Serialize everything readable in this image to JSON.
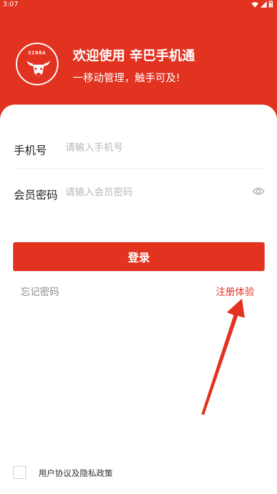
{
  "status_bar": {
    "time": "3:07"
  },
  "header": {
    "logo_text": "XINBA",
    "title": "欢迎使用 辛巴手机通",
    "subtitle": "一移动管理，触手可及!"
  },
  "form": {
    "phone": {
      "label": "手机号",
      "placeholder": "请输入手机号",
      "value": ""
    },
    "password": {
      "label": "会员密码",
      "placeholder": "请输入会员密码",
      "value": ""
    },
    "login_label": "登录",
    "forgot_label": "忘记密码",
    "register_label": "注册体验"
  },
  "agreement": {
    "label": "用户协议及隐私政策",
    "checked": false
  },
  "colors": {
    "brand": "#e23220",
    "placeholder": "#b8b8b8",
    "muted": "#8a8a8a"
  },
  "icons": [
    "wifi-icon",
    "signal-icon",
    "battery-icon",
    "bull-logo-icon",
    "eye-icon",
    "annotation-arrow"
  ]
}
